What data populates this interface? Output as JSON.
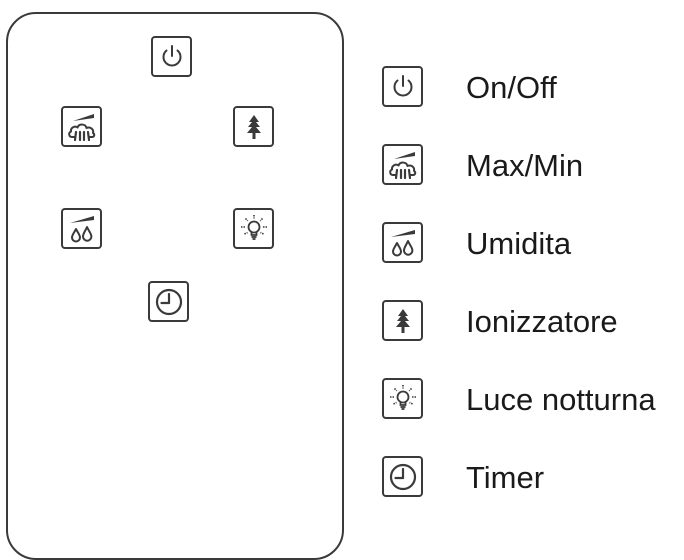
{
  "colors": {
    "stroke": "#3a3a3a",
    "text": "#1a1a1a",
    "background": "#ffffff"
  },
  "remote": {
    "buttons": [
      {
        "icon": "power-icon"
      },
      {
        "icon": "fan-speed-icon"
      },
      {
        "icon": "tree-icon"
      },
      {
        "icon": "humidity-icon"
      },
      {
        "icon": "light-bulb-icon"
      },
      {
        "icon": "clock-icon"
      }
    ]
  },
  "legend": {
    "items": [
      {
        "icon": "power-icon",
        "label": "On/Off"
      },
      {
        "icon": "fan-speed-icon",
        "label": "Max/Min"
      },
      {
        "icon": "humidity-icon",
        "label": "Umidita"
      },
      {
        "icon": "tree-icon",
        "label": "Ionizzatore"
      },
      {
        "icon": "light-bulb-icon",
        "label": "Luce notturna"
      },
      {
        "icon": "clock-icon",
        "label": "Timer"
      }
    ]
  }
}
